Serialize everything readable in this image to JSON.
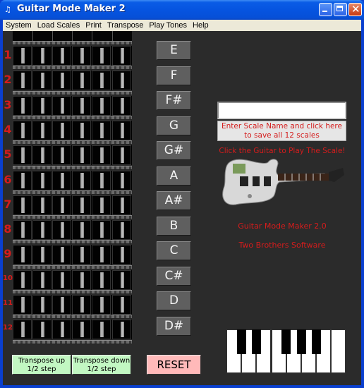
{
  "window": {
    "title": "Guitar Mode Maker 2",
    "icon": "app-icon"
  },
  "menu": [
    "System",
    "Load Scales",
    "Print",
    "Transpose",
    "Play Tones",
    "Help"
  ],
  "fretboard": {
    "frets": [
      "1",
      "2",
      "3",
      "4",
      "5",
      "6",
      "7",
      "8",
      "9",
      "10",
      "11",
      "12"
    ],
    "strings": 6
  },
  "notes": [
    "E",
    "F",
    "F#",
    "G",
    "G#",
    "A",
    "A#",
    "B",
    "C",
    "C#",
    "D",
    "D#"
  ],
  "scale_name": {
    "value": "",
    "save_label_line1": "Enter Scale Name and click here",
    "save_label_line2": "to save all 12 scales"
  },
  "guitar_hint": "Click the Guitar to Play The Scale!",
  "about": {
    "product": "Guitar Mode Maker 2.0",
    "company": "Two Brothers Software"
  },
  "transpose": {
    "up": {
      "line1": "Transpose up",
      "line2": "1/2 step"
    },
    "down": {
      "line1": "Transpose down",
      "line2": "1/2 step"
    }
  },
  "reset_label": "RESET",
  "colors": {
    "accent_red": "#d41c1c",
    "background": "#2b2b2b",
    "note_button": "#5f5f5f",
    "transpose_green": "#c2f7c2",
    "reset_pink": "#ffb9b9"
  }
}
